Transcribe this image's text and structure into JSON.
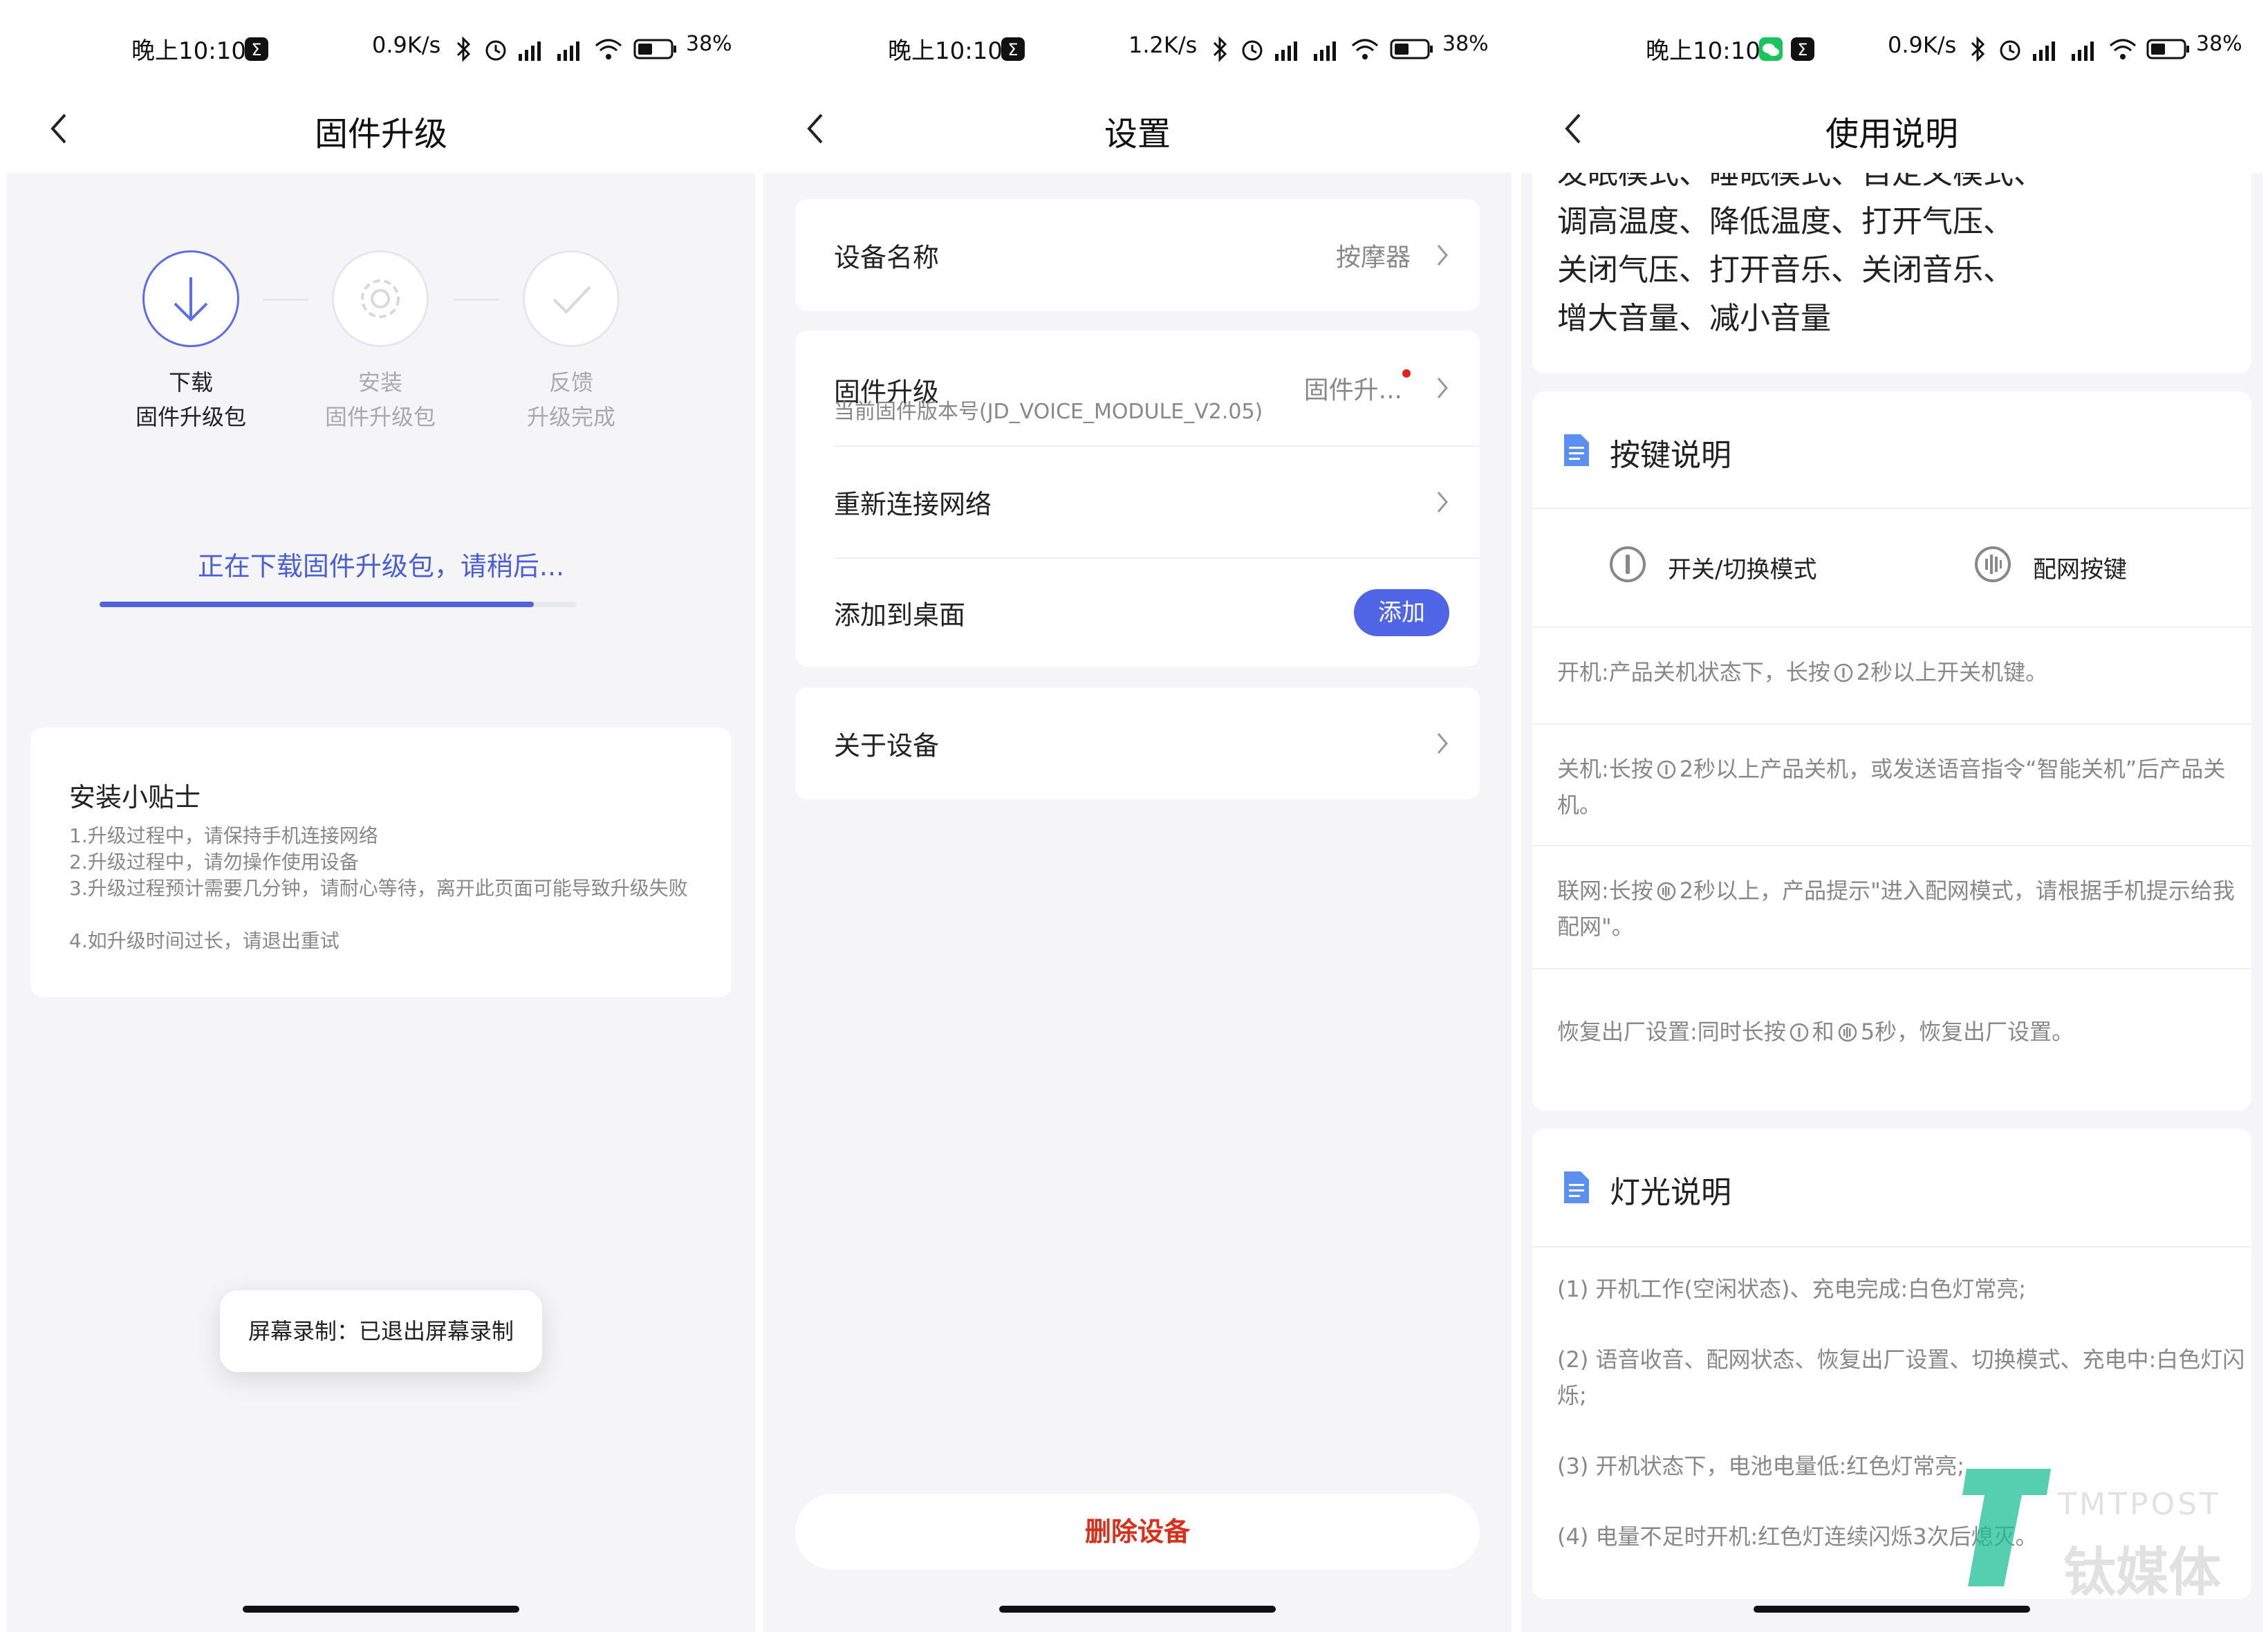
{
  "screen1": {
    "status": {
      "time": "晚上10:10",
      "rate": "0.9K/s",
      "battery": "38%"
    },
    "title": "固件升级",
    "steps": [
      {
        "line1": "下载",
        "line2": "固件升级包"
      },
      {
        "line1": "安装",
        "line2": "固件升级包"
      },
      {
        "line1": "反馈",
        "line2": "升级完成"
      }
    ],
    "progress_text": "正在下载固件升级包，请稍后...",
    "progress": 0.91,
    "tips": {
      "title": "安装小贴士",
      "lines": [
        "1.升级过程中，请保持手机连接网络",
        "2.升级过程中，请勿操作使用设备",
        "3.升级过程预计需要几分钟，请耐心等待，离开此页面可能导致升级失败",
        "4.如升级时间过长，请退出重试"
      ]
    },
    "toast": "屏幕录制：已退出屏幕录制"
  },
  "screen2": {
    "status": {
      "time": "晚上10:10",
      "rate": "1.2K/s",
      "battery": "38%"
    },
    "title": "设置",
    "device_name": {
      "label": "设备名称",
      "value": "按摩器"
    },
    "firmware": {
      "label": "固件升级",
      "sub": "当前固件版本号(JD_VOICE_MODULE_V2.05)",
      "value": "固件升..."
    },
    "reconnect": {
      "label": "重新连接网络"
    },
    "add_desktop": {
      "label": "添加到桌面",
      "button": "添加"
    },
    "about": {
      "label": "关于设备"
    },
    "delete": "删除设备"
  },
  "screen3": {
    "status": {
      "time": "晚上10:10",
      "rate": "0.9K/s",
      "battery": "38%"
    },
    "title": "使用说明",
    "features": [
      "发眠模式、睡眠模式、自定义模式、",
      "调高温度、降低温度、打开气压、",
      "关闭气压、打开音乐、关闭音乐、",
      "增大音量、减小音量"
    ],
    "keys_title": "按键说明",
    "keys": {
      "power": "开关/切换模式",
      "network": "配网按键"
    },
    "key_desc": {
      "on_a": "开机:产品关机状态下，长按",
      "on_b": "2秒以上开关机键。",
      "off_a": "关机:长按",
      "off_b": "2秒以上产品关机，或发送语音指令“智能关机”后产品关机。",
      "net_a": "联网:长按",
      "net_b": "2秒以上，产品提示\"进入配网模式，请根据手机提示给我配网\"。",
      "reset_a": "恢复出厂设置:同时长按",
      "reset_b": "和",
      "reset_c": "5秒，恢复出厂设置。"
    },
    "light_title": "灯光说明",
    "light": [
      "(1) 开机工作(空闲状态)、充电完成:白色灯常亮;",
      "(2) 语音收音、配网状态、恢复出厂设置、切换模式、充电中:白色灯闪烁;",
      "(3) 开机状态下，电池电量低:红色灯常亮;",
      "(4) 电量不足时开机:红色灯连续闪烁3次后熄灭。"
    ]
  },
  "watermark": {
    "latin": "TMTPOST",
    "cn": "钛媒体"
  },
  "colors": {
    "accent": "#4f63dc",
    "danger": "#d9301c",
    "badge": "#e0201b"
  }
}
